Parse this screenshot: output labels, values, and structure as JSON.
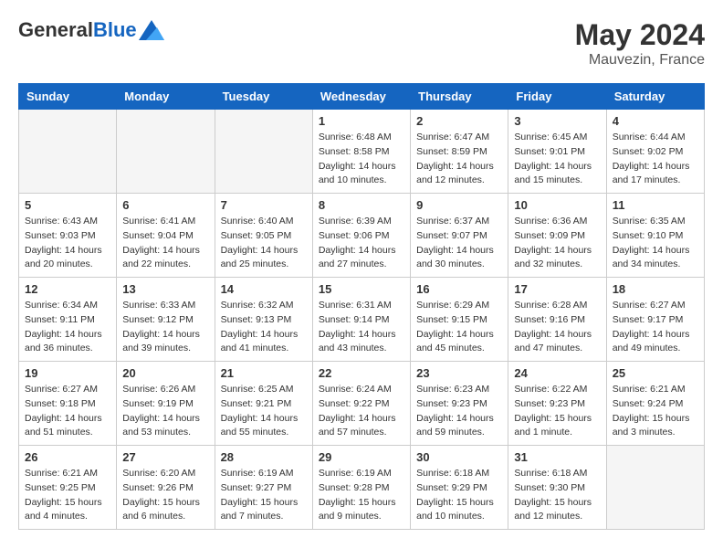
{
  "header": {
    "logo_general": "General",
    "logo_blue": "Blue",
    "month_year": "May 2024",
    "location": "Mauvezin, France"
  },
  "days_of_week": [
    "Sunday",
    "Monday",
    "Tuesday",
    "Wednesday",
    "Thursday",
    "Friday",
    "Saturday"
  ],
  "weeks": [
    [
      {
        "day": "",
        "empty": true
      },
      {
        "day": "",
        "empty": true
      },
      {
        "day": "",
        "empty": true
      },
      {
        "day": "1",
        "sunrise": "6:48 AM",
        "sunset": "8:58 PM",
        "daylight": "14 hours and 10 minutes."
      },
      {
        "day": "2",
        "sunrise": "6:47 AM",
        "sunset": "8:59 PM",
        "daylight": "14 hours and 12 minutes."
      },
      {
        "day": "3",
        "sunrise": "6:45 AM",
        "sunset": "9:01 PM",
        "daylight": "14 hours and 15 minutes."
      },
      {
        "day": "4",
        "sunrise": "6:44 AM",
        "sunset": "9:02 PM",
        "daylight": "14 hours and 17 minutes."
      }
    ],
    [
      {
        "day": "5",
        "sunrise": "6:43 AM",
        "sunset": "9:03 PM",
        "daylight": "14 hours and 20 minutes."
      },
      {
        "day": "6",
        "sunrise": "6:41 AM",
        "sunset": "9:04 PM",
        "daylight": "14 hours and 22 minutes."
      },
      {
        "day": "7",
        "sunrise": "6:40 AM",
        "sunset": "9:05 PM",
        "daylight": "14 hours and 25 minutes."
      },
      {
        "day": "8",
        "sunrise": "6:39 AM",
        "sunset": "9:06 PM",
        "daylight": "14 hours and 27 minutes."
      },
      {
        "day": "9",
        "sunrise": "6:37 AM",
        "sunset": "9:07 PM",
        "daylight": "14 hours and 30 minutes."
      },
      {
        "day": "10",
        "sunrise": "6:36 AM",
        "sunset": "9:09 PM",
        "daylight": "14 hours and 32 minutes."
      },
      {
        "day": "11",
        "sunrise": "6:35 AM",
        "sunset": "9:10 PM",
        "daylight": "14 hours and 34 minutes."
      }
    ],
    [
      {
        "day": "12",
        "sunrise": "6:34 AM",
        "sunset": "9:11 PM",
        "daylight": "14 hours and 36 minutes."
      },
      {
        "day": "13",
        "sunrise": "6:33 AM",
        "sunset": "9:12 PM",
        "daylight": "14 hours and 39 minutes."
      },
      {
        "day": "14",
        "sunrise": "6:32 AM",
        "sunset": "9:13 PM",
        "daylight": "14 hours and 41 minutes."
      },
      {
        "day": "15",
        "sunrise": "6:31 AM",
        "sunset": "9:14 PM",
        "daylight": "14 hours and 43 minutes."
      },
      {
        "day": "16",
        "sunrise": "6:29 AM",
        "sunset": "9:15 PM",
        "daylight": "14 hours and 45 minutes."
      },
      {
        "day": "17",
        "sunrise": "6:28 AM",
        "sunset": "9:16 PM",
        "daylight": "14 hours and 47 minutes."
      },
      {
        "day": "18",
        "sunrise": "6:27 AM",
        "sunset": "9:17 PM",
        "daylight": "14 hours and 49 minutes."
      }
    ],
    [
      {
        "day": "19",
        "sunrise": "6:27 AM",
        "sunset": "9:18 PM",
        "daylight": "14 hours and 51 minutes."
      },
      {
        "day": "20",
        "sunrise": "6:26 AM",
        "sunset": "9:19 PM",
        "daylight": "14 hours and 53 minutes."
      },
      {
        "day": "21",
        "sunrise": "6:25 AM",
        "sunset": "9:21 PM",
        "daylight": "14 hours and 55 minutes."
      },
      {
        "day": "22",
        "sunrise": "6:24 AM",
        "sunset": "9:22 PM",
        "daylight": "14 hours and 57 minutes."
      },
      {
        "day": "23",
        "sunrise": "6:23 AM",
        "sunset": "9:23 PM",
        "daylight": "14 hours and 59 minutes."
      },
      {
        "day": "24",
        "sunrise": "6:22 AM",
        "sunset": "9:23 PM",
        "daylight": "15 hours and 1 minute."
      },
      {
        "day": "25",
        "sunrise": "6:21 AM",
        "sunset": "9:24 PM",
        "daylight": "15 hours and 3 minutes."
      }
    ],
    [
      {
        "day": "26",
        "sunrise": "6:21 AM",
        "sunset": "9:25 PM",
        "daylight": "15 hours and 4 minutes."
      },
      {
        "day": "27",
        "sunrise": "6:20 AM",
        "sunset": "9:26 PM",
        "daylight": "15 hours and 6 minutes."
      },
      {
        "day": "28",
        "sunrise": "6:19 AM",
        "sunset": "9:27 PM",
        "daylight": "15 hours and 7 minutes."
      },
      {
        "day": "29",
        "sunrise": "6:19 AM",
        "sunset": "9:28 PM",
        "daylight": "15 hours and 9 minutes."
      },
      {
        "day": "30",
        "sunrise": "6:18 AM",
        "sunset": "9:29 PM",
        "daylight": "15 hours and 10 minutes."
      },
      {
        "day": "31",
        "sunrise": "6:18 AM",
        "sunset": "9:30 PM",
        "daylight": "15 hours and 12 minutes."
      },
      {
        "day": "",
        "empty": true
      }
    ]
  ],
  "labels": {
    "sunrise": "Sunrise:",
    "sunset": "Sunset:",
    "daylight": "Daylight:"
  }
}
